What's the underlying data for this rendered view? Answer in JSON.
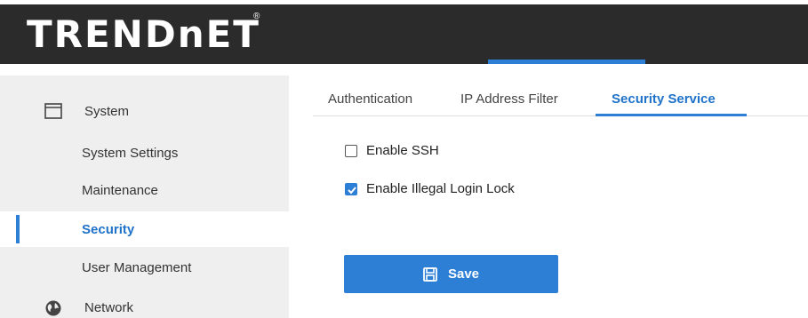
{
  "header": {
    "logo_text": "TRENDnET",
    "logo_mark": "®"
  },
  "sidebar": {
    "items": [
      {
        "label": "System",
        "icon": "window-icon",
        "type": "main"
      },
      {
        "label": "System Settings",
        "type": "sub"
      },
      {
        "label": "Maintenance",
        "type": "sub"
      },
      {
        "label": "Security",
        "type": "sub",
        "active": true
      },
      {
        "label": "User Management",
        "type": "sub"
      },
      {
        "label": "Network",
        "icon": "globe-icon",
        "type": "main"
      }
    ]
  },
  "tabs": [
    {
      "label": "Authentication"
    },
    {
      "label": "IP Address Filter"
    },
    {
      "label": "Security Service",
      "active": true
    }
  ],
  "options": [
    {
      "label": "Enable SSH",
      "checked": false
    },
    {
      "label": "Enable Illegal Login Lock",
      "checked": true
    }
  ],
  "save_button": {
    "label": "Save",
    "icon": "save-icon"
  },
  "colors": {
    "accent": "#2d7fd6",
    "header_bg": "#2b2b2b",
    "sidebar_bg": "#efefef",
    "active_text": "#1f72c9"
  }
}
